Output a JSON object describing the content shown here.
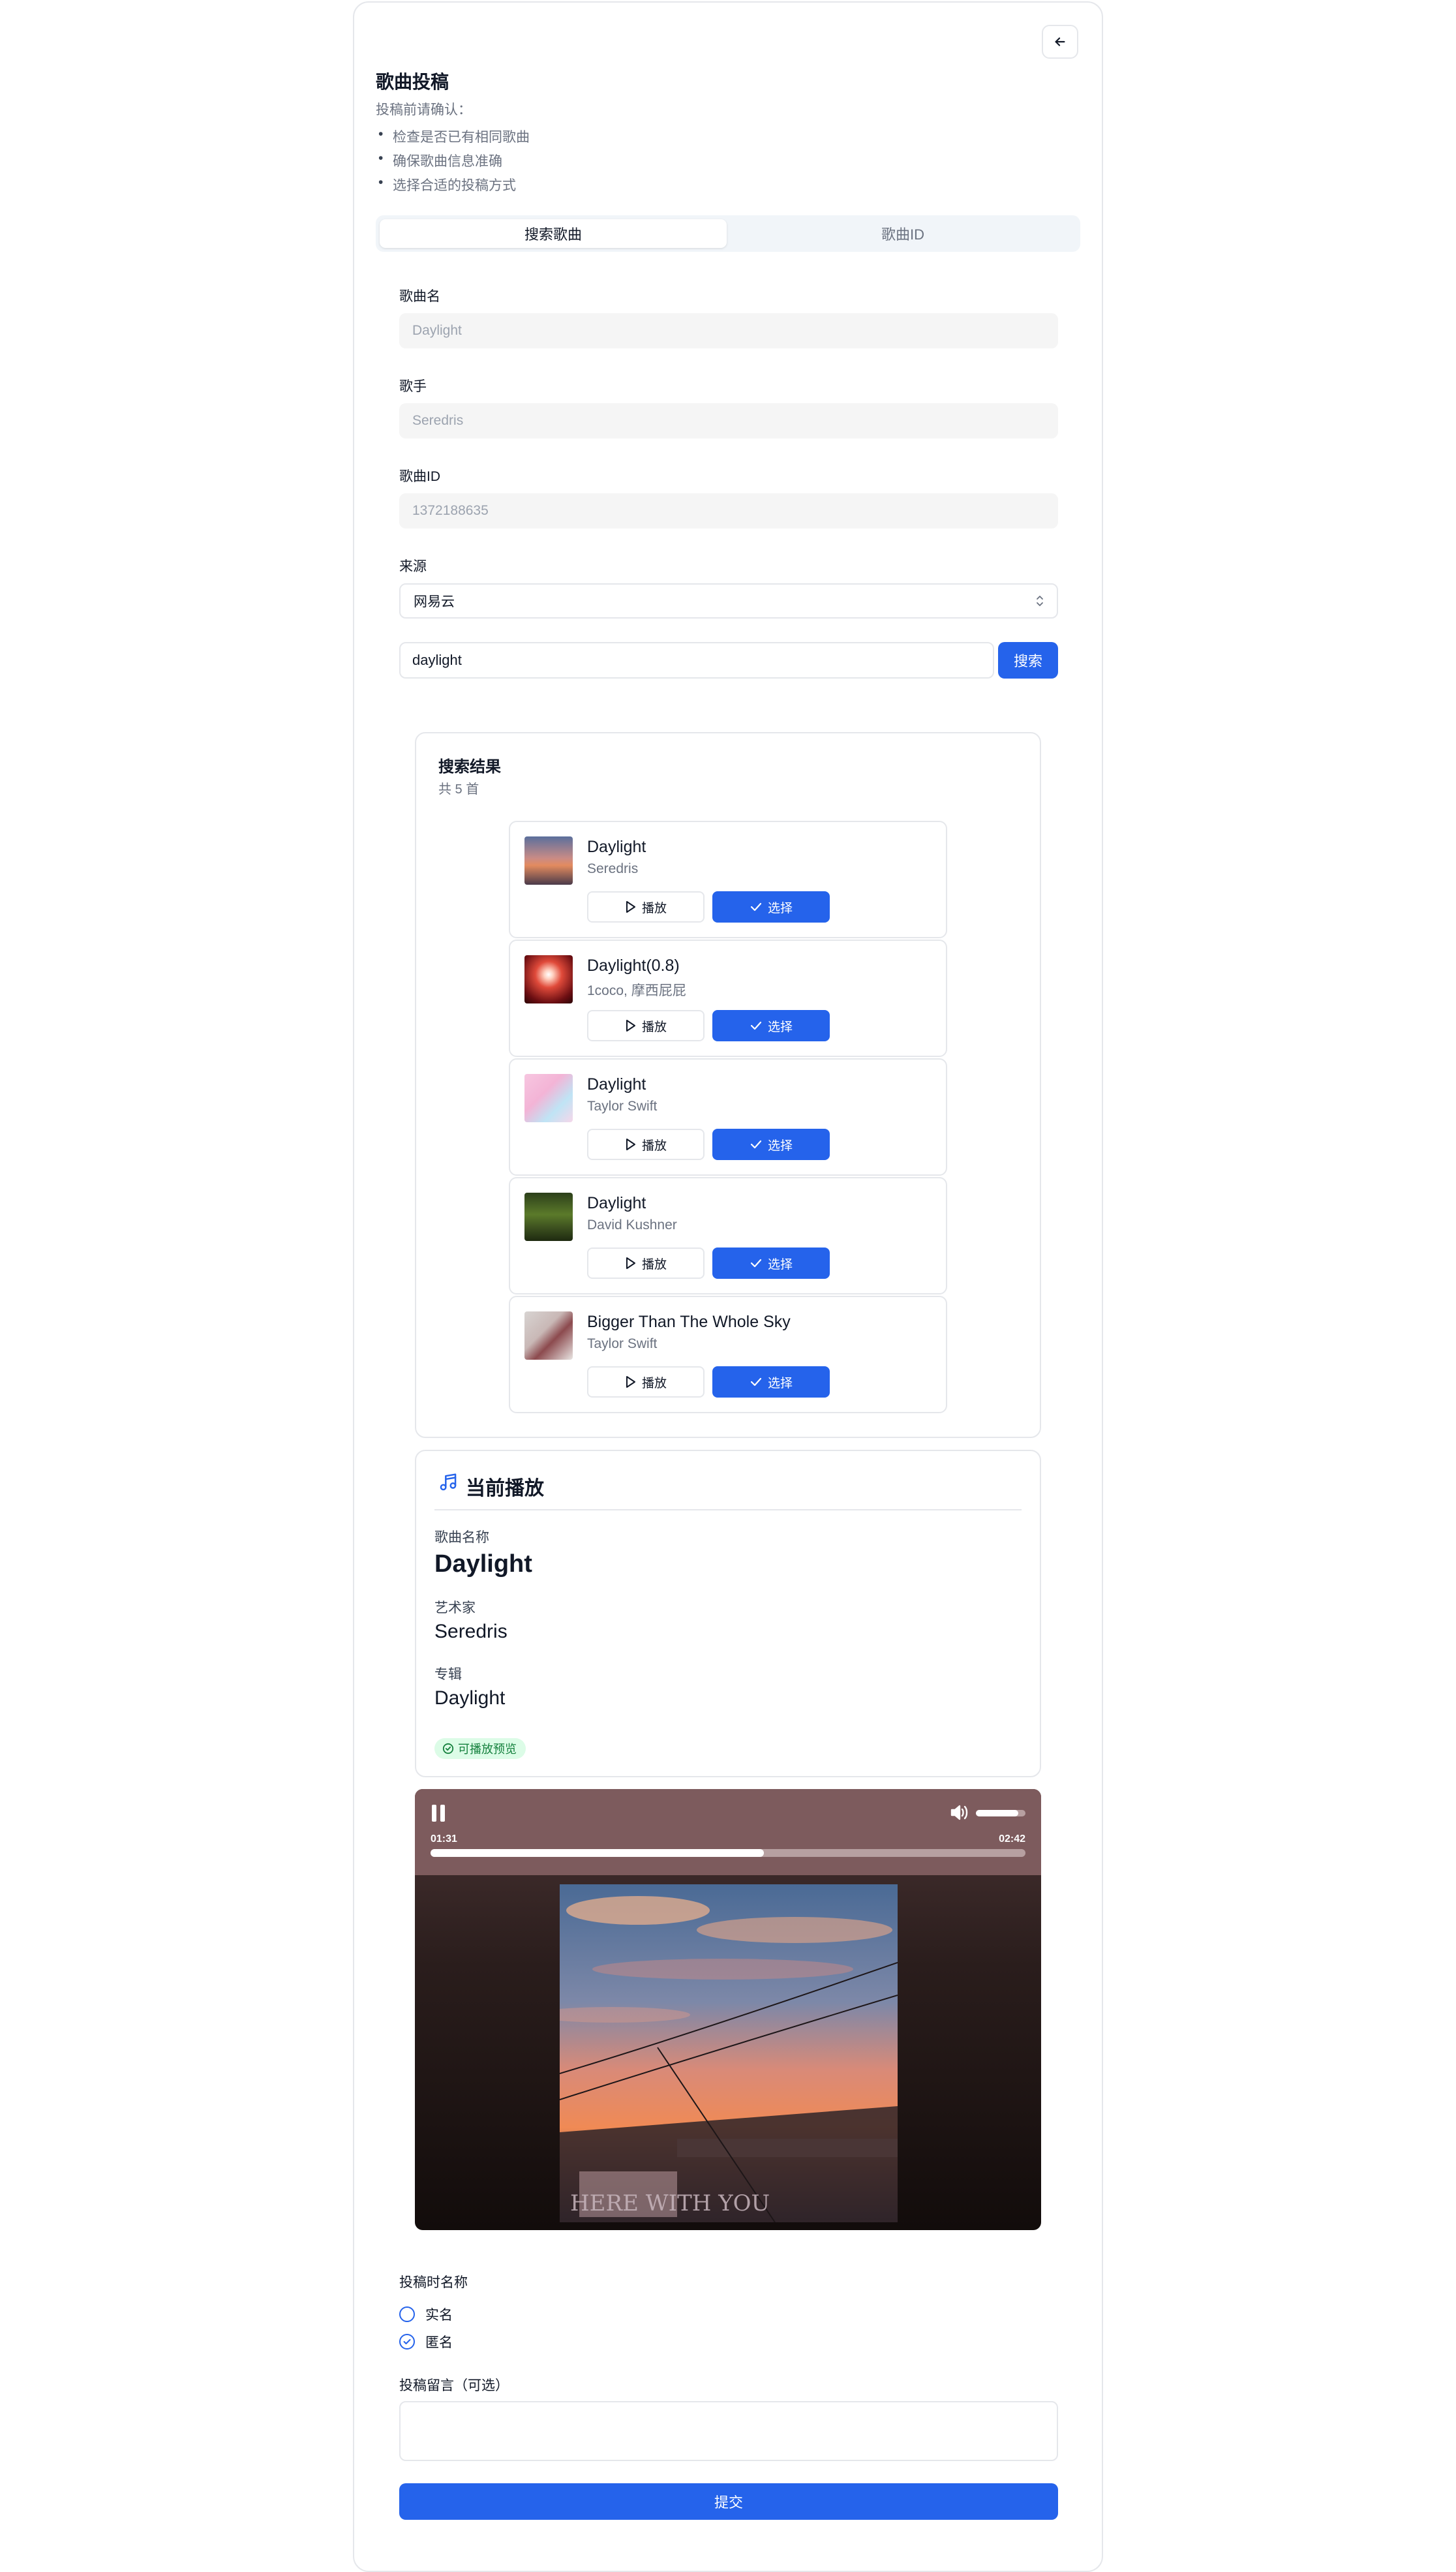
{
  "page": {
    "title": "歌曲投稿",
    "subtitle": "投稿前请确认：",
    "checklist": [
      "检查是否已有相同歌曲",
      "确保歌曲信息准确",
      "选择合适的投稿方式"
    ]
  },
  "tabs": [
    {
      "label": "搜索歌曲",
      "active": true
    },
    {
      "label": "歌曲ID",
      "active": false
    }
  ],
  "form": {
    "song_name_label": "歌曲名",
    "song_name_value": "Daylight",
    "artist_label": "歌手",
    "artist_value": "Seredris",
    "song_id_label": "歌曲ID",
    "song_id_value": "1372188635",
    "source_label": "来源",
    "source_value": "网易云",
    "search_value": "daylight",
    "search_button": "搜索"
  },
  "results": {
    "title": "搜索结果",
    "count": "共 5 首",
    "play_label": "播放",
    "select_label": "选择",
    "items": [
      {
        "name": "Daylight",
        "artist": "Seredris"
      },
      {
        "name": "Daylight(0.8)",
        "artist": "1coco, 摩西屁屁"
      },
      {
        "name": "Daylight",
        "artist": "Taylor Swift"
      },
      {
        "name": "Daylight",
        "artist": "David Kushner"
      },
      {
        "name": "Bigger Than The Whole Sky",
        "artist": "Taylor Swift"
      }
    ]
  },
  "now_playing": {
    "title": "当前播放",
    "song_label": "歌曲名称",
    "song_value": "Daylight",
    "artist_label": "艺术家",
    "artist_value": "Seredris",
    "album_label": "专辑",
    "album_value": "Daylight",
    "badge": "可播放预览"
  },
  "player": {
    "current_time": "01:31",
    "duration": "02:42",
    "progress": 0.56,
    "volume": 0.85,
    "state": "playing",
    "album_art_text": "HERE WITH YOU"
  },
  "submit_options": {
    "name_label": "投稿时名称",
    "options": [
      {
        "label": "实名",
        "checked": false
      },
      {
        "label": "匿名",
        "checked": true
      }
    ],
    "message_label": "投稿留言（可选）",
    "message_value": "",
    "submit_label": "提交"
  },
  "colors": {
    "accent": "#2563eb",
    "muted_text": "#6b7280",
    "border": "#e5e7eb",
    "badge_bg": "#dcfce7",
    "badge_text": "#15803d",
    "player_header": "#7d5b5d"
  }
}
